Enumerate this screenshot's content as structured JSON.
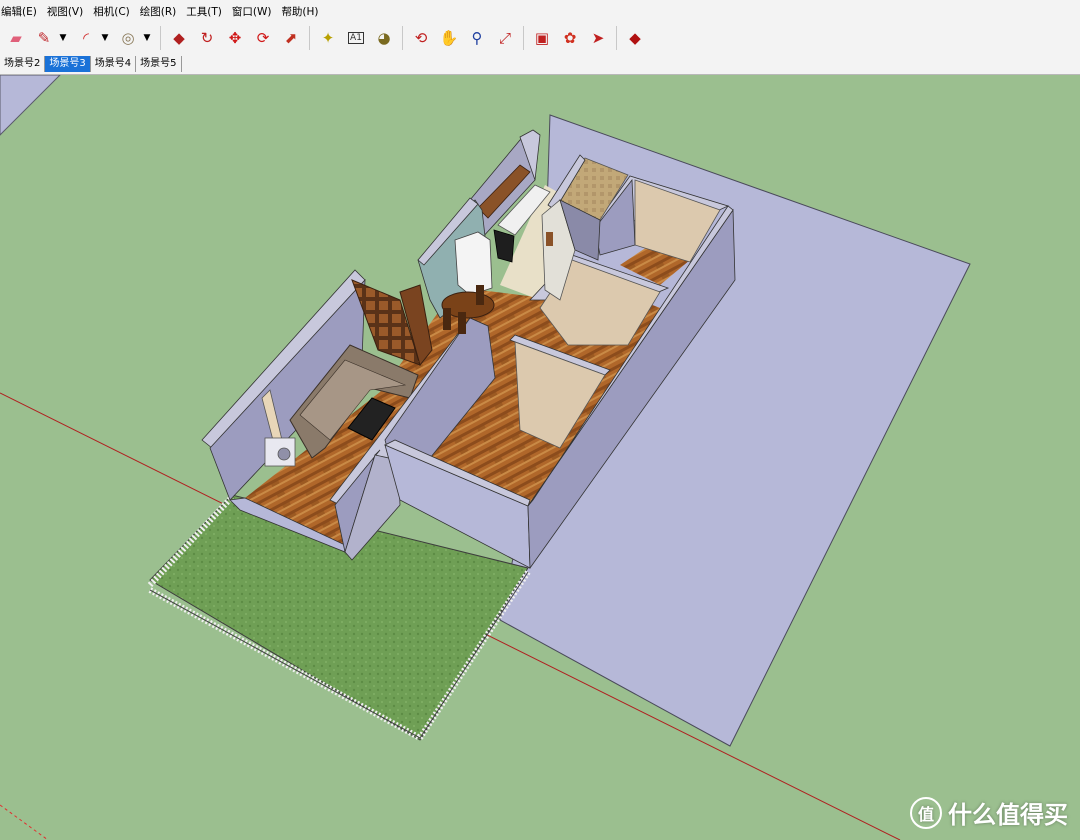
{
  "menu": [
    "编辑(E)",
    "视图(V)",
    "相机(C)",
    "绘图(R)",
    "工具(T)",
    "窗口(W)",
    "帮助(H)"
  ],
  "toolbar": {
    "tools": [
      {
        "name": "eraser-icon",
        "glyph": "▰",
        "color": "#e0607a"
      },
      {
        "name": "pencil-icon",
        "glyph": "✎",
        "color": "#c0282d",
        "dropdown": "▼"
      },
      {
        "name": "arc-icon",
        "glyph": "◜",
        "color": "#d02828",
        "dropdown": "▼"
      },
      {
        "name": "circle-icon",
        "glyph": "◎",
        "color": "#8a7a5a",
        "dropdown": "▼"
      },
      {
        "name": "push-pull-icon",
        "glyph": "◆",
        "color": "#b02020"
      },
      {
        "name": "follow-me-icon",
        "glyph": "↻",
        "color": "#c02020"
      },
      {
        "name": "move-icon",
        "glyph": "✥",
        "color": "#d01818"
      },
      {
        "name": "rotate-icon",
        "glyph": "⟳",
        "color": "#d01818"
      },
      {
        "name": "scale-icon",
        "glyph": "⬈",
        "color": "#c03020"
      },
      {
        "name": "tape-measure-icon",
        "glyph": "✦",
        "color": "#b8a000"
      },
      {
        "name": "text-icon",
        "glyph": "A1",
        "color": "#333333"
      },
      {
        "name": "paint-bucket-icon",
        "glyph": "◕",
        "color": "#7a6a20"
      },
      {
        "name": "orbit-icon",
        "glyph": "⟲",
        "color": "#c02020"
      },
      {
        "name": "pan-icon",
        "glyph": "✋",
        "color": "#c89050"
      },
      {
        "name": "zoom-icon",
        "glyph": "⚲",
        "color": "#2040a0"
      },
      {
        "name": "zoom-extents-icon",
        "glyph": "⤢",
        "color": "#c02020"
      },
      {
        "name": "warehouse-icon",
        "glyph": "▣",
        "color": "#c02020"
      },
      {
        "name": "components-icon",
        "glyph": "✿",
        "color": "#d03020"
      },
      {
        "name": "share-model-icon",
        "glyph": "➤",
        "color": "#c02020"
      },
      {
        "name": "ruby-icon",
        "glyph": "◆",
        "color": "#b01010"
      }
    ]
  },
  "scenes": {
    "tabs": [
      "场景号2",
      "场景号3",
      "场景号4",
      "场景号5"
    ],
    "active": "场景号3"
  },
  "colors": {
    "ground": "#9bbf8f",
    "slab": "#b6b8d8",
    "wall_interior": "#dcc9ae",
    "wall_exterior": "#9b9bbf",
    "floor_wood": "#b06a2a",
    "garden": "#6e9e54",
    "axis_red": "#b02020"
  },
  "watermark": {
    "logo": "值",
    "text": "什么值得买"
  }
}
